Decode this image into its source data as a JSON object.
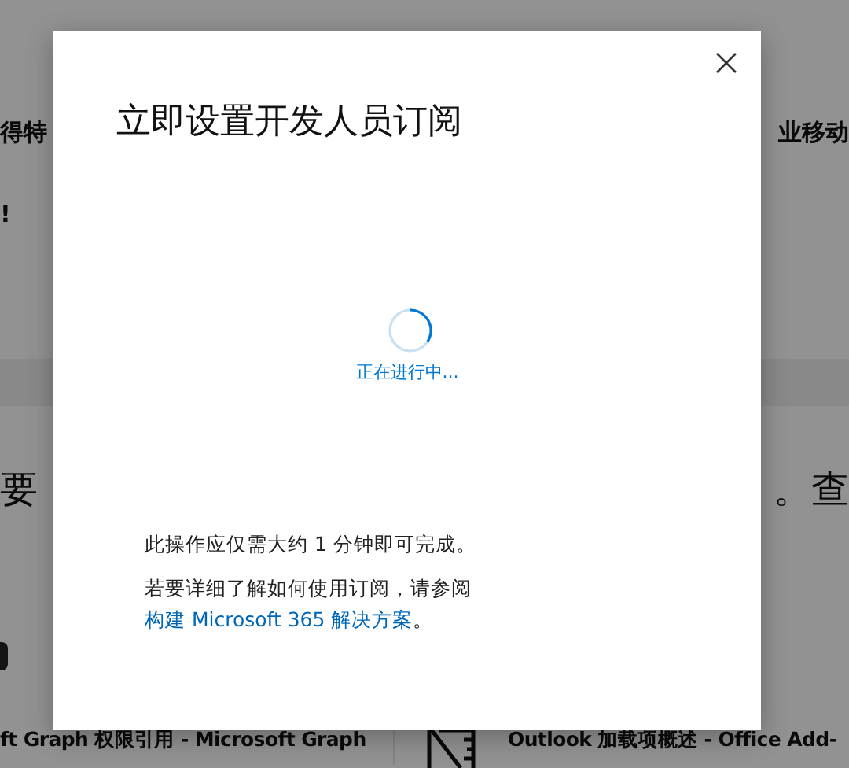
{
  "background": {
    "row_1": {
      "left": "得特",
      "right": "业移动"
    },
    "row_2": {
      "left": "!"
    },
    "heading_row": {
      "left": "要",
      "right": "。查"
    },
    "cards": [
      {
        "title": "ft Graph 权限引用 - Microsoft Graph"
      },
      {
        "title": "Outlook 加载项概述 - Office Add-"
      }
    ]
  },
  "dialog": {
    "title": "立即设置开发人员订阅",
    "status": "正在进行中...",
    "note": "此操作应仅需大约 1 分钟即可完成。",
    "info": {
      "text": "若要详细了解如何使用订阅，请参阅",
      "link": "构建 Microsoft 365 解决方案",
      "end": "。"
    }
  }
}
